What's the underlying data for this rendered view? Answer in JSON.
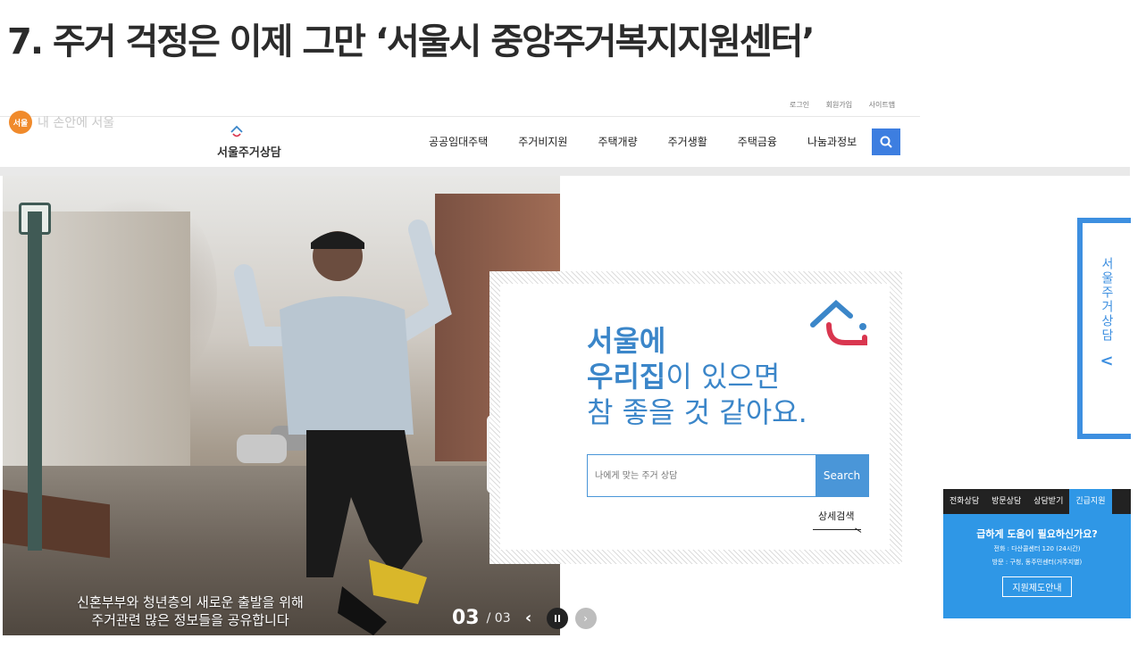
{
  "slide": {
    "title": "7. 주거 걱정은 이제 그만 ‘서울시 중앙주거복지지원센터’"
  },
  "util": [
    "로그인",
    "회원가입",
    "사이트맵"
  ],
  "seoul_logo": {
    "mark": "서울",
    "slogan": "내 손안에 서울"
  },
  "brand": {
    "name": "서울주거상담"
  },
  "gnb": [
    "공공임대주택",
    "주거비지원",
    "주택개량",
    "주거생활",
    "주택금융",
    "나눔과정보"
  ],
  "hero": {
    "caption_line1": "신혼부부와 청년층의 새로운 출발을 위해",
    "caption_line2": "주거관련 많은 정보들을 공유합니다",
    "page_current": "03",
    "page_total": "/ 03"
  },
  "promo": {
    "line1": "서울에",
    "line2_bold": "우리집",
    "line2_rest": "이 있으면",
    "line3": "참 좋을 것 같아요.",
    "search_placeholder": "나에게 맞는 주거 상담",
    "search_button": "Search",
    "detail_link": "상세검색"
  },
  "side_tab": {
    "label": "서울주거상담",
    "chevron": "<"
  },
  "consult": {
    "tabs": [
      "전화상담",
      "방문상담",
      "상담받기",
      "긴급지원"
    ],
    "question": "급하게 도움이 필요하신가요?",
    "phone": "전화 : 다산콜센터 120 (24시간)",
    "visit": "방문 : 구청, 동주민센터(거주지별)",
    "button": "지원제도안내"
  },
  "colors": {
    "accent": "#3b86c9",
    "brand_blue": "#3d7ee0",
    "widget_blue": "#2f97e6",
    "logo_orange": "#f08a2b",
    "mark_red": "#d9364f"
  }
}
